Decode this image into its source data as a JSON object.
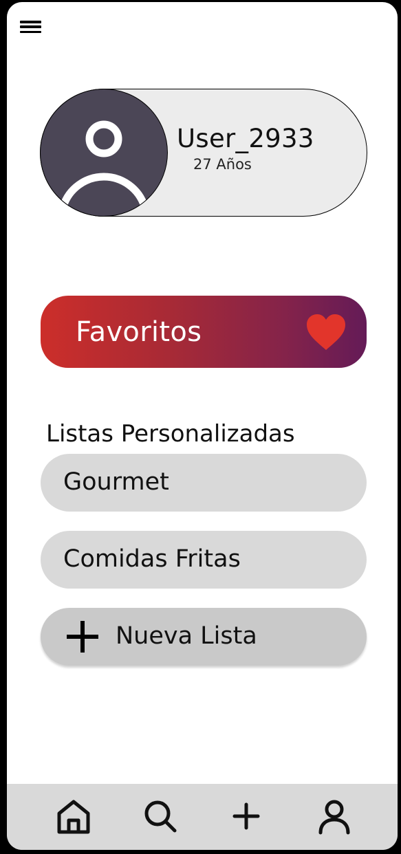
{
  "header": {
    "menu_icon": "menu-icon"
  },
  "profile": {
    "username": "User_2933",
    "age": "27 Años",
    "avatar_icon": "user-avatar-icon"
  },
  "favorites": {
    "label": "Favoritos",
    "icon": "heart-icon",
    "gradient": [
      "#cc2e2a",
      "#641b57"
    ],
    "heart_color": "#e2352b"
  },
  "custom_lists": {
    "title": "Listas Personalizadas",
    "items": [
      {
        "label": "Gourmet"
      },
      {
        "label": "Comidas Fritas"
      }
    ],
    "new_list_label": "Nueva Lista",
    "new_list_icon": "plus-icon"
  },
  "bottom_nav": {
    "items": [
      {
        "icon": "home-icon"
      },
      {
        "icon": "search-icon"
      },
      {
        "icon": "plus-icon"
      },
      {
        "icon": "profile-icon"
      }
    ]
  }
}
